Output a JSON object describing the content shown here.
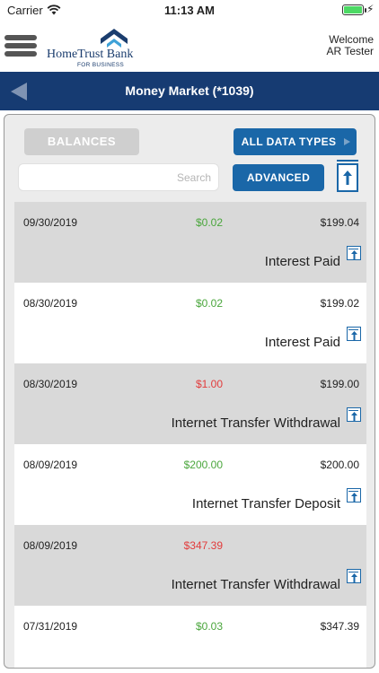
{
  "status_bar": {
    "carrier": "Carrier",
    "time": "11:13 AM",
    "battery_level": 1.0
  },
  "header": {
    "logo_name": "HomeTrust Bank",
    "logo_sub": "FOR BUSINESS",
    "welcome": "Welcome",
    "user": "AR Tester",
    "menu_icon": "hamburger-menu-icon",
    "brand_color": "#1b3d6e"
  },
  "nav": {
    "title": "Money Market (*1039)",
    "back_icon": "back-arrow-icon",
    "bar_color": "#163b72"
  },
  "toolbar": {
    "balances_label": "BALANCES",
    "data_types_label": "ALL DATA TYPES",
    "advanced_label": "ADVANCED",
    "search_placeholder": "Search",
    "search_value": "",
    "export_icon": "upload-icon",
    "accent_color": "#1a67a8"
  },
  "transactions": [
    {
      "date": "09/30/2019",
      "amount": "$0.02",
      "balance": "$199.04",
      "description": "Interest Paid",
      "type": "credit"
    },
    {
      "date": "08/30/2019",
      "amount": "$0.02",
      "balance": "$199.02",
      "description": "Interest Paid",
      "type": "credit"
    },
    {
      "date": "08/30/2019",
      "amount": "$1.00",
      "balance": "$199.00",
      "description": "Internet Transfer Withdrawal",
      "type": "debit"
    },
    {
      "date": "08/09/2019",
      "amount": "$200.00",
      "balance": "$200.00",
      "description": "Internet Transfer Deposit",
      "type": "credit"
    },
    {
      "date": "08/09/2019",
      "amount": "$347.39",
      "balance": "",
      "description": "Internet Transfer Withdrawal",
      "type": "debit"
    },
    {
      "date": "07/31/2019",
      "amount": "$0.03",
      "balance": "$347.39",
      "description": "",
      "type": "credit"
    }
  ],
  "colors": {
    "credit": "#4aa63c",
    "debit": "#e23b3b"
  }
}
